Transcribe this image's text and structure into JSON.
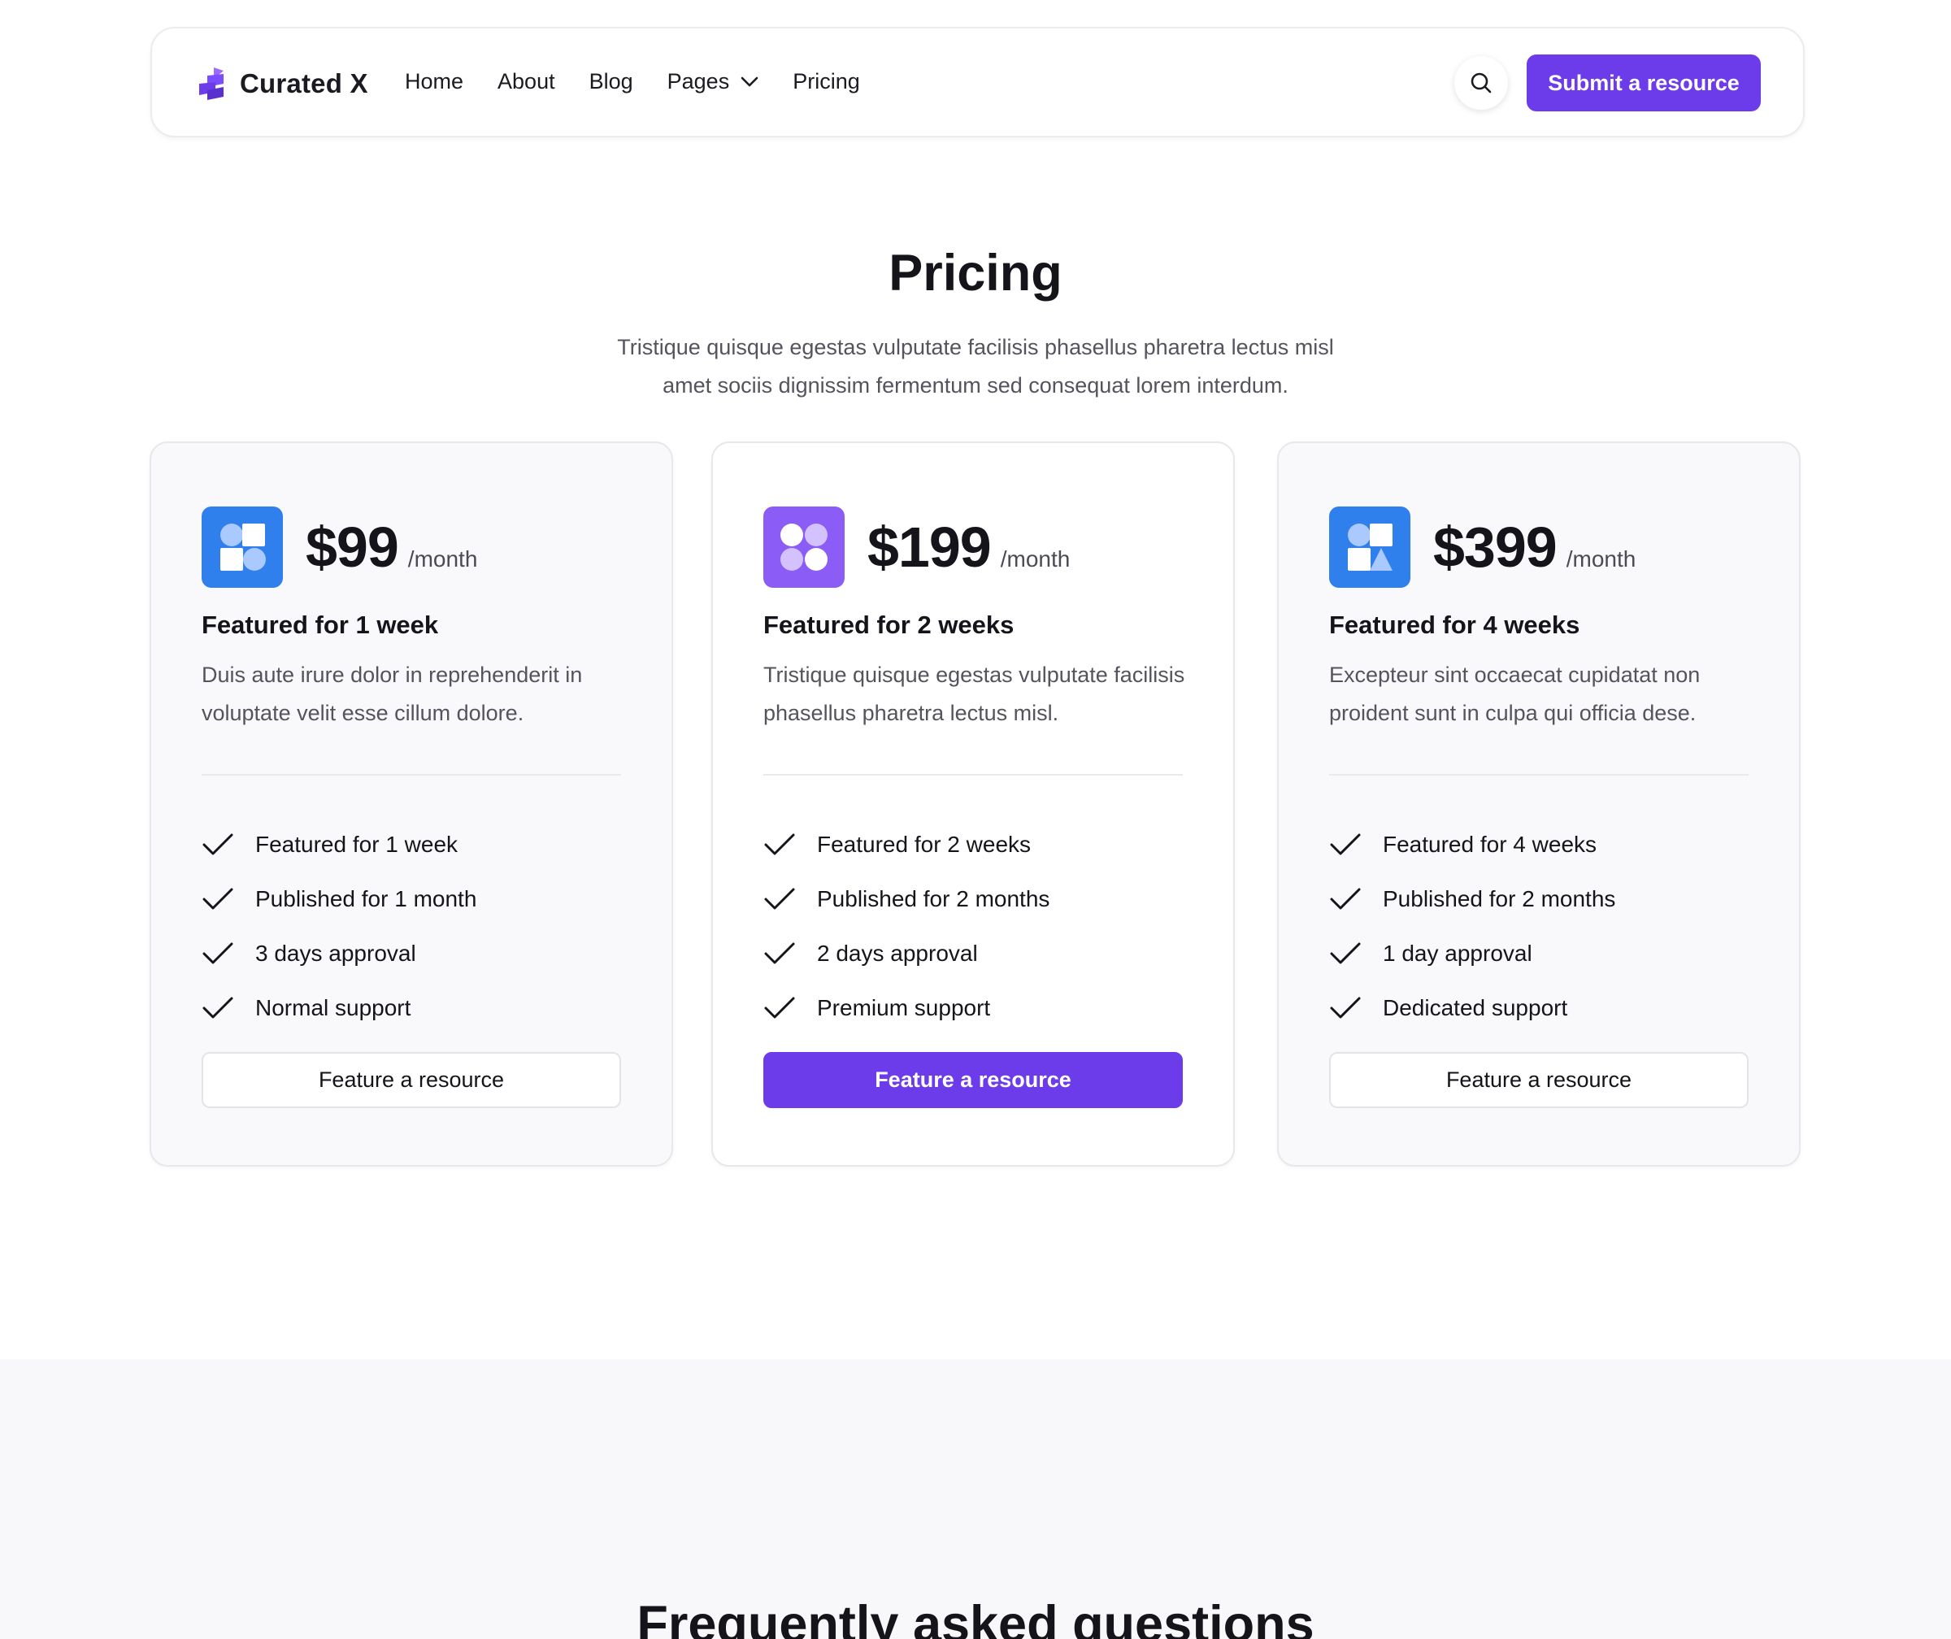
{
  "brand": {
    "name": "Curated X",
    "accent_color": "#6d3cea"
  },
  "nav": {
    "links": [
      {
        "label": "Home"
      },
      {
        "label": "About"
      },
      {
        "label": "Blog"
      },
      {
        "label": "Pages",
        "has_dropdown": true
      },
      {
        "label": "Pricing"
      }
    ],
    "search_icon": "search-icon",
    "cta_label": "Submit a resource"
  },
  "hero": {
    "title": "Pricing",
    "subtitle_line1": "Tristique quisque egestas vulputate facilisis phasellus pharetra lectus misl",
    "subtitle_line2": "amet sociis dignissim fermentum sed consequat lorem interdum."
  },
  "plans": [
    {
      "price": "$99",
      "period": "/month",
      "title": "Featured for 1 week",
      "description": "Duis aute irure dolor in reprehenderit in voluptate velit esse cillum dolore.",
      "icon_color": "#2f80ed",
      "features": [
        "Featured for 1 week",
        "Published for 1 month",
        "3 days approval",
        "Normal support"
      ],
      "cta_label": "Feature a resource",
      "highlighted": false
    },
    {
      "price": "$199",
      "period": "/month",
      "title": "Featured for 2 weeks",
      "description": "Tristique quisque egestas vulputate facilisis phasellus pharetra lectus misl.",
      "icon_color": "#8b5cf6",
      "features": [
        "Featured for 2 weeks",
        "Published for 2 months",
        "2 days approval",
        "Premium support"
      ],
      "cta_label": "Feature a resource",
      "highlighted": true
    },
    {
      "price": "$399",
      "period": "/month",
      "title": "Featured for 4 weeks",
      "description": "Excepteur sint occaecat cupidatat non proident sunt in culpa qui officia dese.",
      "icon_color": "#2f80ed",
      "features": [
        "Featured for 4 weeks",
        "Published for 2 months",
        "1 day approval",
        "Dedicated support"
      ],
      "cta_label": "Feature a resource",
      "highlighted": false
    }
  ],
  "faq": {
    "title": "Frequently asked questions"
  }
}
